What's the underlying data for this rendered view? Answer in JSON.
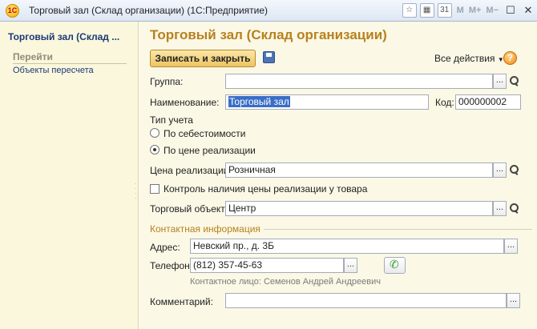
{
  "window": {
    "logo": "1С",
    "title": "Торговый зал (Склад организации)  (1С:Предприятие)",
    "toolbar_m": "M",
    "toolbar_mplus": "M+",
    "toolbar_mminus": "M−"
  },
  "sidebar": {
    "title": "Торговый зал (Склад ...",
    "section": "Перейти",
    "links": [
      "Объекты пересчета"
    ]
  },
  "form": {
    "title": "Торговый зал (Склад организации)",
    "save_close": "Записать и закрыть",
    "all_actions": "Все действия",
    "help": "?",
    "group_label": "Группа:",
    "group_value": "",
    "name_label": "Наименование:",
    "name_value": "Торговый зал",
    "code_label": "Код:",
    "code_value": "000000002",
    "accounting_type_label": "Тип учета",
    "radio_cost": "По себестоимости",
    "radio_price": "По цене реализации",
    "price_label": "Цена реализации:",
    "price_value": "Розничная",
    "price_check_label": "Контроль наличия цены реализации у товара",
    "trade_object_label": "Торговый объект:",
    "trade_object_value": "Центр",
    "contact_group": "Контактная информация",
    "address_label": "Адрес:",
    "address_value": "Невский пр., д. 3Б",
    "phone_label": "Телефон:",
    "phone_value": "(812) 357-45-63",
    "contact_person": "Контактное лицо: Семенов Андрей Андреевич",
    "comment_label": "Комментарий:",
    "comment_value": "",
    "ellipsis": "..."
  }
}
